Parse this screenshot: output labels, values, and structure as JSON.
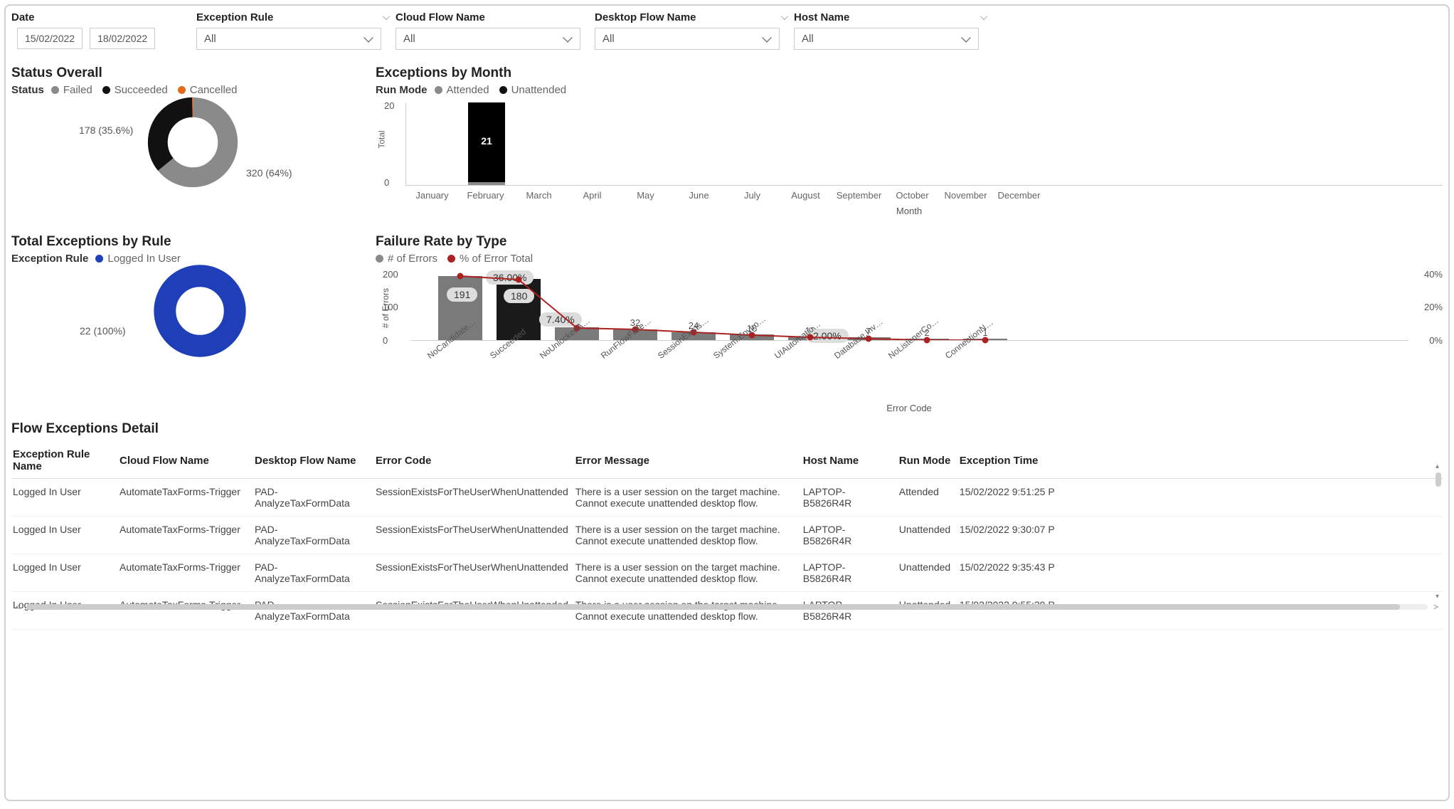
{
  "filters": {
    "date_label": "Date",
    "date_from": "15/02/2022",
    "date_to": "18/02/2022",
    "exception_rule_label": "Exception Rule",
    "exception_rule_value": "All",
    "cloud_flow_label": "Cloud Flow Name",
    "cloud_flow_value": "All",
    "desktop_flow_label": "Desktop Flow Name",
    "desktop_flow_value": "All",
    "host_name_label": "Host Name",
    "host_name_value": "All"
  },
  "status_overall": {
    "title": "Status Overall",
    "legend_title": "Status",
    "legend": [
      {
        "label": "Failed",
        "color": "#8a8a8a"
      },
      {
        "label": "Succeeded",
        "color": "#111111"
      },
      {
        "label": "Cancelled",
        "color": "#e06a1a"
      }
    ],
    "left_annotation": "178 (35.6%)",
    "right_annotation": "320 (64%)"
  },
  "exceptions_by_month": {
    "title": "Exceptions by Month",
    "legend_title": "Run Mode",
    "legend": [
      {
        "label": "Attended",
        "color": "#8a8a8a"
      },
      {
        "label": "Unattended",
        "color": "#111111"
      }
    ],
    "y_title": "Total",
    "y_ticks": [
      "20",
      "0"
    ],
    "x_title": "Month",
    "bar_label": "21"
  },
  "total_exceptions_by_rule": {
    "title": "Total Exceptions by Rule",
    "legend_title": "Exception Rule",
    "legend": [
      {
        "label": "Logged In User",
        "color": "#1f3fb8"
      }
    ],
    "annotation": "22 (100%)"
  },
  "failure_rate": {
    "title": "Failure Rate by Type",
    "legend": [
      {
        "label": "# of Errors",
        "color": "#8a8a8a"
      },
      {
        "label": "% of Error Total",
        "color": "#a22"
      }
    ],
    "y_left_title": "# of Errors",
    "y_left_ticks": [
      "200",
      "100",
      "0"
    ],
    "y_right_ticks": [
      "40%",
      "20%",
      "0%"
    ],
    "x_title": "Error Code",
    "val_labels": [
      "37",
      "32",
      "24",
      "16",
      "10",
      "7",
      "2",
      "1"
    ],
    "bubble_191": "191",
    "bubble_180": "180",
    "bubble_36": "36.00%",
    "bubble_740": "7.40%",
    "bubble_200": "2.00%"
  },
  "table": {
    "title": "Flow Exceptions Detail",
    "headers": {
      "exception_rule": "Exception Rule Name",
      "cloud_flow": "Cloud Flow Name",
      "desktop_flow": "Desktop Flow Name",
      "error_code": "Error Code",
      "error_message": "Error Message",
      "host_name": "Host Name",
      "run_mode": "Run Mode",
      "exception_time": "Exception Time"
    },
    "rows": [
      {
        "rule": "Logged In User",
        "cloud": "AutomateTaxForms-Trigger",
        "desktop": "PAD-AnalyzeTaxFormData",
        "code": "SessionExistsForTheUserWhenUnattended",
        "msg": "There is a user session on the target machine. Cannot execute unattended desktop flow.",
        "host": "LAPTOP-B5826R4R",
        "mode": "Attended",
        "time": "15/02/2022 9:51:25 P"
      },
      {
        "rule": "Logged In User",
        "cloud": "AutomateTaxForms-Trigger",
        "desktop": "PAD-AnalyzeTaxFormData",
        "code": "SessionExistsForTheUserWhenUnattended",
        "msg": "There is a user session on the target machine. Cannot execute unattended desktop flow.",
        "host": "LAPTOP-B5826R4R",
        "mode": "Unattended",
        "time": "15/02/2022 9:30:07 P"
      },
      {
        "rule": "Logged In User",
        "cloud": "AutomateTaxForms-Trigger",
        "desktop": "PAD-AnalyzeTaxFormData",
        "code": "SessionExistsForTheUserWhenUnattended",
        "msg": "There is a user session on the target machine. Cannot execute unattended desktop flow.",
        "host": "LAPTOP-B5826R4R",
        "mode": "Unattended",
        "time": "15/02/2022 9:35:43 P"
      },
      {
        "rule": "Logged In User",
        "cloud": "AutomateTaxForms-Trigger",
        "desktop": "PAD-AnalyzeTaxFormData",
        "code": "SessionExistsForTheUserWhenUnattended",
        "msg": "There is a user session on the target machine. Cannot execute unattended desktop flow.",
        "host": "LAPTOP-B5826R4R",
        "mode": "Unattended",
        "time": "15/02/2022 9:55:29 P"
      }
    ]
  },
  "chart_data": [
    {
      "type": "pie",
      "title": "Status Overall",
      "series": [
        {
          "name": "Failed",
          "value": 320,
          "percent": 64.0,
          "color": "#8a8a8a"
        },
        {
          "name": "Succeeded",
          "value": 178,
          "percent": 35.6,
          "color": "#111111"
        },
        {
          "name": "Cancelled",
          "value": 2,
          "percent": 0.4,
          "color": "#e06a1a"
        }
      ]
    },
    {
      "type": "bar",
      "title": "Exceptions by Month",
      "xlabel": "Month",
      "ylabel": "Total",
      "ylim": [
        0,
        25
      ],
      "categories": [
        "January",
        "February",
        "March",
        "April",
        "May",
        "June",
        "July",
        "August",
        "September",
        "October",
        "November",
        "December"
      ],
      "series": [
        {
          "name": "Attended",
          "values": [
            0,
            1,
            0,
            0,
            0,
            0,
            0,
            0,
            0,
            0,
            0,
            0
          ],
          "color": "#8a8a8a"
        },
        {
          "name": "Unattended",
          "values": [
            0,
            20,
            0,
            0,
            0,
            0,
            0,
            0,
            0,
            0,
            0,
            0
          ],
          "color": "#111111"
        }
      ],
      "stack_total_labels": [
        "",
        "21",
        "",
        "",
        "",
        "",
        "",
        "",
        "",
        "",
        "",
        ""
      ]
    },
    {
      "type": "pie",
      "title": "Total Exceptions by Rule",
      "series": [
        {
          "name": "Logged In User",
          "value": 22,
          "percent": 100.0,
          "color": "#1f3fb8"
        }
      ]
    },
    {
      "type": "bar",
      "title": "Failure Rate by Type",
      "xlabel": "Error Code",
      "ylabel": "# of Errors",
      "y2label": "% of Error Total",
      "ylim": [
        0,
        200
      ],
      "y2lim": [
        0,
        40
      ],
      "categories": [
        "NoCandidate…",
        "Succeeded",
        "NoUnlockedA…",
        "RunFlowFaile…",
        "SessionExists…",
        "System.Enviro…",
        "UIAutomatio…",
        "Database.Inv…",
        "NoListenerCo…",
        "ConnectionN…"
      ],
      "series": [
        {
          "name": "# of Errors",
          "axis": "y",
          "values": [
            191,
            180,
            37,
            32,
            24,
            16,
            10,
            7,
            2,
            1
          ],
          "color": "#7a7a7a"
        },
        {
          "name": "% of Error Total",
          "axis": "y2",
          "type": "line",
          "values": [
            38.2,
            36.0,
            7.4,
            6.4,
            4.8,
            3.2,
            2.0,
            1.4,
            0.4,
            0.2
          ],
          "color": "#a22"
        }
      ]
    }
  ]
}
